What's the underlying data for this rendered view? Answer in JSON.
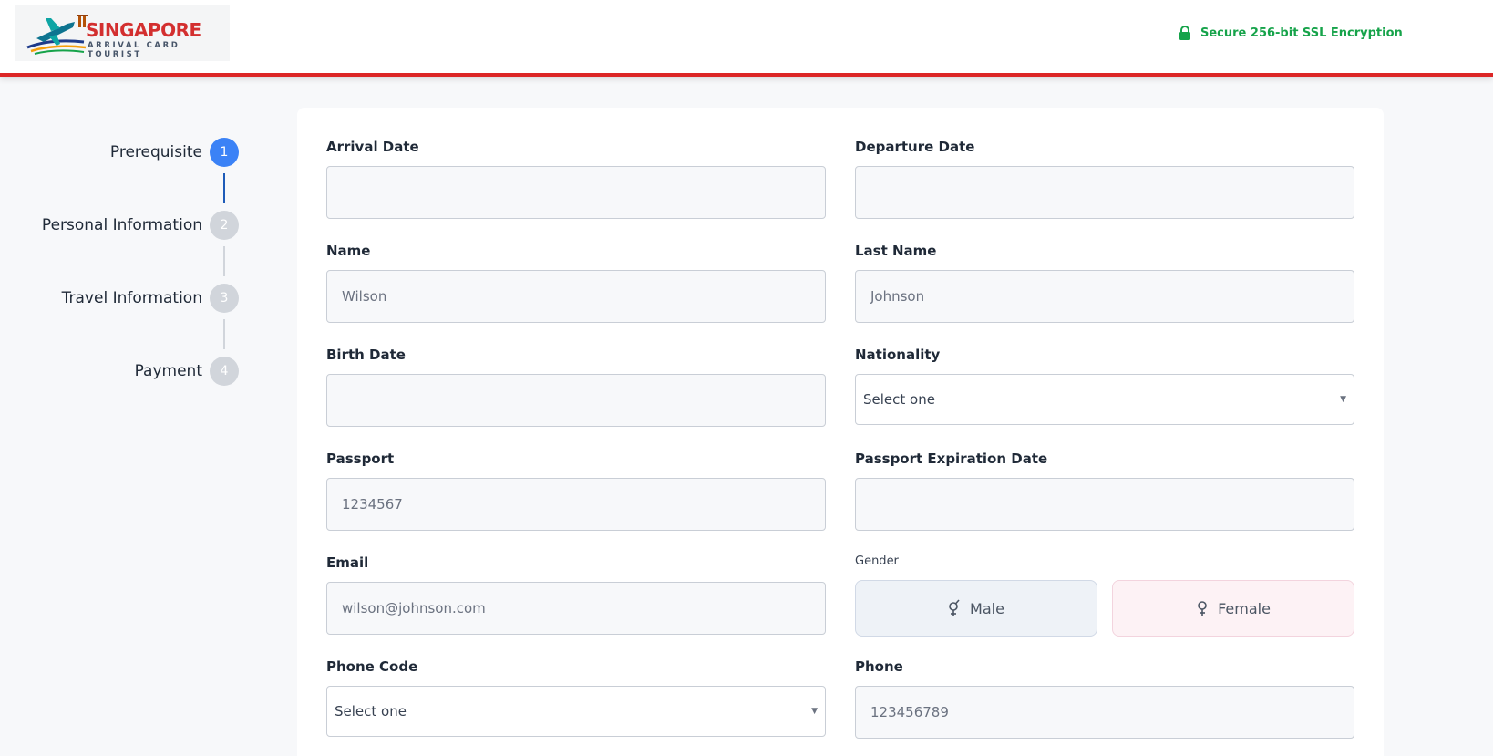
{
  "header": {
    "logo": {
      "title": "SINGAPORE",
      "subtitle": "ARRIVAL CARD TOURIST"
    },
    "secure_text": "Secure 256-bit SSL Encryption",
    "colors": {
      "accent_red": "#dc2626",
      "secure_green": "#16a34a"
    }
  },
  "stepper": {
    "steps": [
      {
        "label": "Prerequisite",
        "number": "1",
        "active": true
      },
      {
        "label": "Personal Information",
        "number": "2",
        "active": false
      },
      {
        "label": "Travel Information",
        "number": "3",
        "active": false
      },
      {
        "label": "Payment",
        "number": "4",
        "active": false
      }
    ],
    "colors": {
      "active": "#3b82f6",
      "inactive": "#d1d5db"
    }
  },
  "form": {
    "arrival_date": {
      "label": "Arrival Date",
      "value": ""
    },
    "departure_date": {
      "label": "Departure Date",
      "value": ""
    },
    "name": {
      "label": "Name",
      "placeholder": "Wilson"
    },
    "last_name": {
      "label": "Last Name",
      "placeholder": "Johnson"
    },
    "birth_date": {
      "label": "Birth Date",
      "value": ""
    },
    "nationality": {
      "label": "Nationality",
      "selected": "Select one"
    },
    "passport": {
      "label": "Passport",
      "placeholder": "1234567"
    },
    "passport_expiration": {
      "label": "Passport Expiration Date",
      "value": ""
    },
    "email": {
      "label": "Email",
      "placeholder": "wilson@johnson.com"
    },
    "gender": {
      "label": "Gender",
      "male": "Male",
      "female": "Female"
    },
    "phone_code": {
      "label": "Phone Code",
      "selected": "Select one"
    },
    "phone": {
      "label": "Phone",
      "placeholder": "123456789"
    }
  }
}
